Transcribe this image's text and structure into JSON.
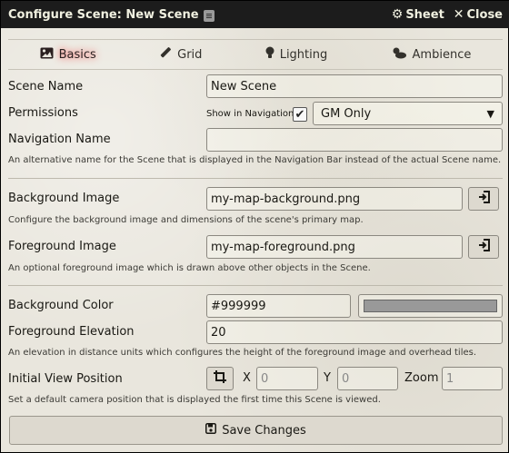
{
  "window": {
    "title": "Configure Scene: New Scene",
    "sheet_label": "Sheet",
    "close_label": "Close"
  },
  "tabs": [
    {
      "label": "Basics",
      "icon": "image-icon",
      "active": true
    },
    {
      "label": "Grid",
      "icon": "ruler-icon",
      "active": false
    },
    {
      "label": "Lighting",
      "icon": "lightbulb-icon",
      "active": false
    },
    {
      "label": "Ambience",
      "icon": "cloud-sun-icon",
      "active": false
    }
  ],
  "scene_name": {
    "label": "Scene Name",
    "value": "New Scene"
  },
  "permissions": {
    "label": "Permissions",
    "nav_label": "Show in Navigation",
    "nav_checked": true,
    "selected": "GM Only"
  },
  "navigation_name": {
    "label": "Navigation Name",
    "value": "",
    "hint": "An alternative name for the Scene that is displayed in the Navigation Bar instead of the actual Scene name."
  },
  "background_image": {
    "label": "Background Image",
    "value": "my-map-background.png",
    "hint": "Configure the background image and dimensions of the scene's primary map."
  },
  "foreground_image": {
    "label": "Foreground Image",
    "value": "my-map-foreground.png",
    "hint": "An optional foreground image which is drawn above other objects in the Scene."
  },
  "background_color": {
    "label": "Background Color",
    "value": "#999999",
    "swatch": "#999999"
  },
  "foreground_elevation": {
    "label": "Foreground Elevation",
    "value": "20",
    "hint": "An elevation in distance units which configures the height of the foreground image and overhead tiles."
  },
  "initial_view": {
    "label": "Initial View Position",
    "x_label": "X",
    "x_placeholder": "0",
    "y_label": "Y",
    "y_placeholder": "0",
    "zoom_label": "Zoom",
    "zoom_placeholder": "1",
    "hint": "Set a default camera position that is displayed the first time this Scene is viewed."
  },
  "save_label": "Save Changes"
}
